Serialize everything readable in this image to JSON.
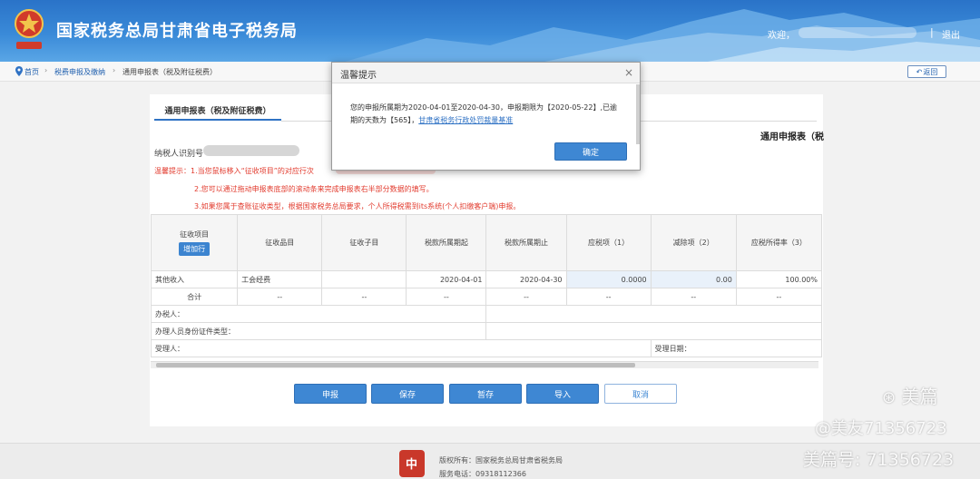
{
  "header": {
    "site_title": "国家税务总局甘肃省电子税务局",
    "welcome": "欢迎，",
    "separator": "|",
    "logout": "退出"
  },
  "breadcrumb": {
    "home": "首页",
    "level1": "税费申报及缴纳",
    "arrow": "›",
    "current": "通用申报表（税及附征税费）",
    "back": "返回"
  },
  "form": {
    "tab": "通用申报表（税及附征税费）",
    "title": "通用申报表（税",
    "taxpayer_id_label": "纳税人识别号",
    "tips": [
      "温馨提示：1.当您鼠标移入“征收项目”的对应行次",
      "2.您可以通过拖动申报表底部的滚动条来完成申报表右半部分数据的填写。",
      "3.如果您属于查账征收类型，根据国家税务总局要求，个人所得税需到its系统(个人扣缴客户端)申报。"
    ]
  },
  "table": {
    "headers": [
      "征收项目",
      "征收品目",
      "征收子目",
      "税款所属期起",
      "税款所属期止",
      "应税项（1）",
      "减除项（2）",
      "应税所得率（3）"
    ],
    "add_row": "增加行",
    "row": [
      "其他收入",
      "工会经费",
      "",
      "2020-04-01",
      "2020-04-30",
      "0.0000",
      "0.00",
      "100.00%"
    ],
    "total_label": "合计",
    "dash": "--",
    "handler_label": "办税人：",
    "handler_id_type_label": "办理人员身份证件类型：",
    "receiver_label": "受理人：",
    "receive_date_label": "受理日期："
  },
  "buttons": {
    "submit": "申报",
    "save": "保存",
    "hold": "暂存",
    "import": "导入",
    "cancel": "取消"
  },
  "footer": {
    "copyright": "版权所有：国家税务总局甘肃省税务局",
    "service": "服务电话：09318112366"
  },
  "dialog": {
    "title": "温馨提示",
    "close": "×",
    "message": "您的申报所属期为2020-04-01至2020-04-30，申报期限为【2020-05-22】,已逾期的天数为【565】，",
    "link": "甘肃省税务行政处罚裁量基准",
    "ok": "确定"
  },
  "watermark": {
    "brand": "美篇",
    "user": "@美友71356723",
    "id": "美篇号: 71356723"
  },
  "colors": {
    "header_blue": "#2a73c8",
    "primary_button": "#3e87d3",
    "tip_red": "#e23b2e",
    "link_blue": "#2f72c4"
  }
}
